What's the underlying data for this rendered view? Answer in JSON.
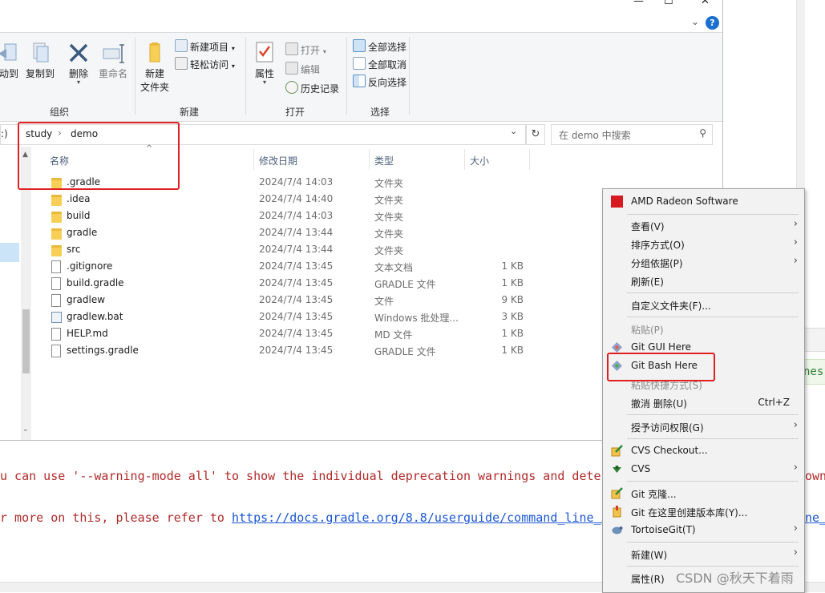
{
  "console": {
    "line1": "u can use '--warning-mode all' to show the individual deprecation warnings and deter",
    "line1_right": "own",
    "line2_prefix": "r more on this, please refer to ",
    "line2_link": "https://docs.gradle.org/8.8/userguide/command_line_i",
    "line2_right": "ne_",
    "nes_tail": "nes"
  },
  "ribbon": {
    "move_label": "动到",
    "copy_label": "复制到",
    "delete_label": "删除",
    "rename_label": "重命名",
    "new_folder_label_1": "新建",
    "new_folder_label_2": "文件夹",
    "new_item_label": "新建项目",
    "easy_access_label": "轻松访问",
    "properties_label": "属性",
    "open_label": "打开",
    "edit_label": "编辑",
    "history_label": "历史记录",
    "select_all_label": "全部选择",
    "select_none_label": "全部取消",
    "invert_label": "反向选择",
    "group_organize": "组织",
    "group_new": "新建",
    "group_open": "打开",
    "group_select": "选择"
  },
  "address": {
    "prefix": ":)",
    "crumb1": "study",
    "crumb2": "demo",
    "search_placeholder": "在 demo 中搜索"
  },
  "columns": {
    "name": "名称",
    "modified": "修改日期",
    "type": "类型",
    "size": "大小"
  },
  "files": [
    {
      "name": ".gradle",
      "date": "2024/7/4 14:03",
      "type": "文件夹",
      "size": "",
      "icon": "folder-icon"
    },
    {
      "name": ".idea",
      "date": "2024/7/4 14:40",
      "type": "文件夹",
      "size": "",
      "icon": "folder-icon"
    },
    {
      "name": "build",
      "date": "2024/7/4 14:03",
      "type": "文件夹",
      "size": "",
      "icon": "folder-icon"
    },
    {
      "name": "gradle",
      "date": "2024/7/4 13:44",
      "type": "文件夹",
      "size": "",
      "icon": "folder-icon"
    },
    {
      "name": "src",
      "date": "2024/7/4 13:44",
      "type": "文件夹",
      "size": "",
      "icon": "folder-icon"
    },
    {
      "name": ".gitignore",
      "date": "2024/7/4 13:45",
      "type": "文本文档",
      "size": "1 KB",
      "icon": "text-file-icon"
    },
    {
      "name": "build.gradle",
      "date": "2024/7/4 13:45",
      "type": "GRADLE 文件",
      "size": "1 KB",
      "icon": "file-icon"
    },
    {
      "name": "gradlew",
      "date": "2024/7/4 13:45",
      "type": "文件",
      "size": "9 KB",
      "icon": "file-icon"
    },
    {
      "name": "gradlew.bat",
      "date": "2024/7/4 13:45",
      "type": "Windows 批处理...",
      "size": "3 KB",
      "icon": "batch-file-icon"
    },
    {
      "name": "HELP.md",
      "date": "2024/7/4 13:45",
      "type": "MD 文件",
      "size": "1 KB",
      "icon": "file-icon"
    },
    {
      "name": "settings.gradle",
      "date": "2024/7/4 13:45",
      "type": "GRADLE 文件",
      "size": "1 KB",
      "icon": "file-icon"
    }
  ],
  "menu": {
    "amd": "AMD Radeon Software",
    "view": "查看(V)",
    "sort": "排序方式(O)",
    "group": "分组依据(P)",
    "refresh": "刷新(E)",
    "customize": "自定义文件夹(F)...",
    "paste": "粘贴(P)",
    "git_gui": "Git GUI Here",
    "git_bash": "Git Bash Here",
    "paste_shortcut": "粘贴快捷方式(S)",
    "undo_delete": "撤消 删除(U)",
    "undo_shortcut": "Ctrl+Z",
    "grant_access": "授予访问权限(G)",
    "cvs_checkout": "CVS Checkout...",
    "cvs": "CVS",
    "git_clone": "Git 克隆...",
    "git_create_repo": "Git 在这里创建版本库(Y)...",
    "tortoisegit": "TortoiseGit(T)",
    "new": "新建(W)",
    "properties": "属性(R)"
  },
  "watermark": "CSDN @秋天下着雨",
  "colors": {
    "highlight_red": "#e02020",
    "folder_yellow": "#f7cf57",
    "console_red": "#b02a2a",
    "link_blue": "#1a57d6"
  }
}
